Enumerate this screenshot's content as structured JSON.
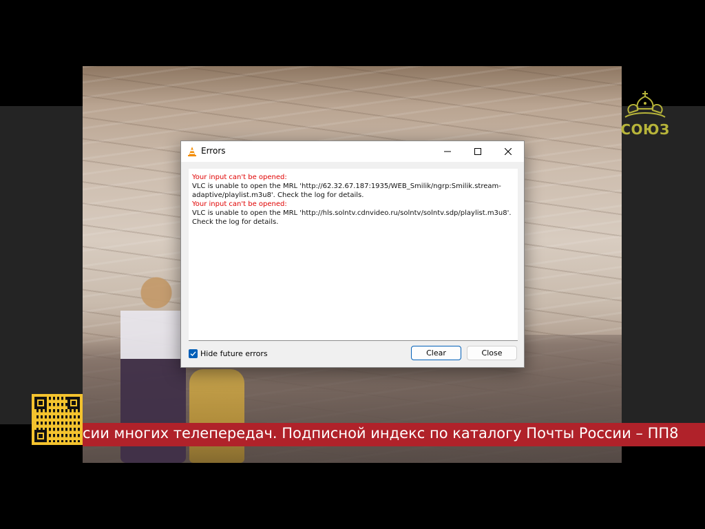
{
  "dialog": {
    "title": "Errors",
    "messages": [
      {
        "heading": "Your input can't be opened:",
        "detail": "VLC is unable to open the MRL 'http://62.32.67.187:1935/WEB_Smilik/ngrp:Smilik.stream-adaptive/playlist.m3u8'. Check the log for details."
      },
      {
        "heading": "Your input can't be opened:",
        "detail": "VLC is unable to open the MRL 'http://hls.solntv.cdnvideo.ru/solntv/solntv.sdp/playlist.m3u8'. Check the log for details."
      }
    ],
    "hide_future_errors": {
      "label": "Hide future errors",
      "checked": true
    },
    "buttons": {
      "clear": "Clear",
      "close": "Close"
    },
    "window_controls": [
      "minimize-icon",
      "maximize-icon",
      "close-icon"
    ]
  },
  "overlay": {
    "logo_text": "СОЮЗ",
    "ticker_text": "сии многих телепередач. Подписной индекс по каталогу Почты России – ПП8"
  },
  "colors": {
    "error_heading": "#e00000",
    "accent": "#005fb8",
    "ticker_bg": "#b0222a",
    "qr_bg": "#f4c32e",
    "logo": "#b7b43a"
  }
}
